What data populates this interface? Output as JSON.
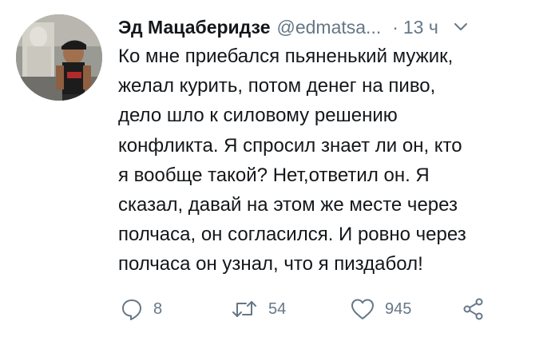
{
  "author": {
    "display_name": "Эд Мацаберидзе",
    "handle": "@edmatsa...",
    "separator": "·",
    "time": "13 ч"
  },
  "tweet": {
    "lines": [
      "Ко мне приебался пьяненький мужик,",
      "желал курить, потом денег на пиво,",
      "дело шло к силовому решению",
      "конфликта. Я спросил знает ли он, кто",
      "я вообще такой? Нет,ответил он. Я",
      "сказал, давай на этом же месте через",
      "полчаса, он согласился. И ровно через",
      "полчаса он узнал, что я пиздабол!"
    ]
  },
  "actions": {
    "reply_count": "8",
    "retweet_count": "54",
    "like_count": "945"
  },
  "icons": {
    "reply": "reply-icon",
    "retweet": "retweet-icon",
    "like": "heart-icon",
    "share": "share-icon",
    "menu": "chevron-down-icon"
  },
  "colors": {
    "text": "#14171a",
    "secondary": "#657786",
    "background": "#ffffff"
  }
}
